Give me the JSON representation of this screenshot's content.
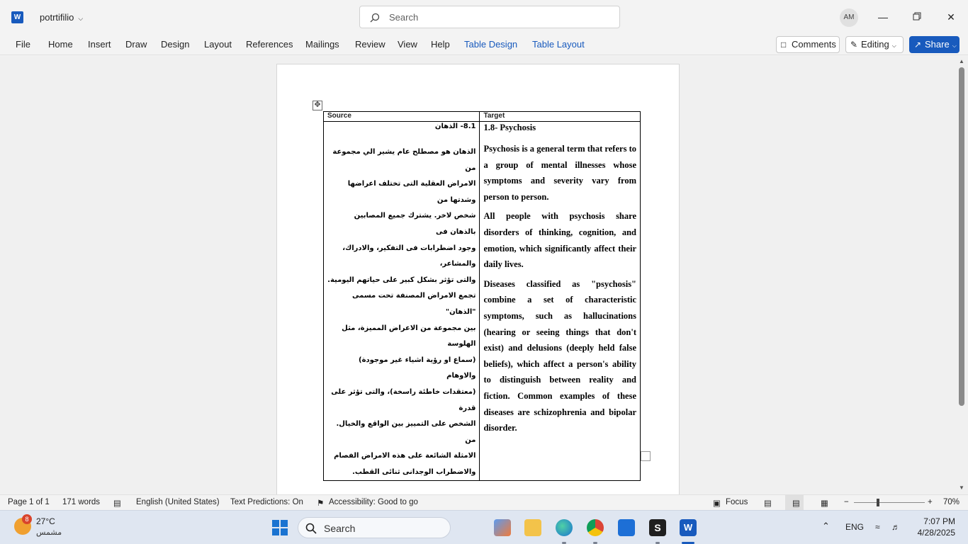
{
  "window": {
    "app_logo": "W",
    "doc_title": "potrtifilio",
    "search_placeholder": "Search",
    "avatar_initials": "AM"
  },
  "ribbon": {
    "tabs": [
      "File",
      "Home",
      "Insert",
      "Draw",
      "Design",
      "Layout",
      "References",
      "Mailings",
      "Review",
      "View",
      "Help",
      "Table Design",
      "Table Layout"
    ],
    "comments_label": "Comments",
    "editing_label": "Editing",
    "share_label": "Share",
    "accent_color": "#185abd"
  },
  "document": {
    "table": {
      "header_source": "Source",
      "header_target": "Target",
      "source_heading": "8.1- الذهان",
      "source_lines": [
        "الذهان هو مصطلح عام يشير الي مجموعة من",
        "الامراض العقلية التى تختلف اعراضها وشدتها من",
        "شخص لاخر. يشترك جميع المصابين بالذهان فى",
        "وجود اضطرابات فى التفكير، والادراك، والمشاعر،",
        "والتى تؤثر بشكل كبير على حياتهم اليومية.",
        "تجمع الامراض المصنفة تحت مسمى \"الذهان\"",
        "بين مجموعة من الاعراض المميزة، مثل الهلوسة",
        "(سماع او رؤية اشياء غير موجودة) والاوهام",
        "(معتقدات خاطئة راسخة)، والتى تؤثر على قدرة",
        "الشخص على التمييز بين الواقع والخيال. من",
        "الامثلة الشائعة على هذه الامراض الفصام",
        "والاضطراب الوجدانى ثنائى القطب."
      ],
      "target_heading": "1.8- Psychosis",
      "target_paragraphs": [
        "Psychosis is a general term that refers to a group of mental illnesses whose symptoms and severity vary from person to person.",
        " All people with psychosis share disorders of thinking, cognition, and emotion, which significantly affect their daily lives.",
        "Diseases classified as \"psychosis\" combine a set of characteristic symptoms, such as hallucinations (hearing or seeing things that don't exist) and delusions (deeply held false beliefs), which affect a person's ability to distinguish between reality and fiction. Common examples of these diseases are schizophrenia and bipolar disorder."
      ]
    }
  },
  "status_bar": {
    "page": "Page 1 of 1",
    "words": "171 words",
    "language": "English (United States)",
    "predictions": "Text Predictions: On",
    "accessibility": "Accessibility: Good to go",
    "focus": "Focus",
    "zoom": "70%"
  },
  "taskbar": {
    "weather_badge": "8",
    "temperature": "27°C",
    "condition": "مشمس",
    "search_label": "Search",
    "language": "ENG",
    "time": "7:07 PM",
    "date": "4/28/2025"
  }
}
